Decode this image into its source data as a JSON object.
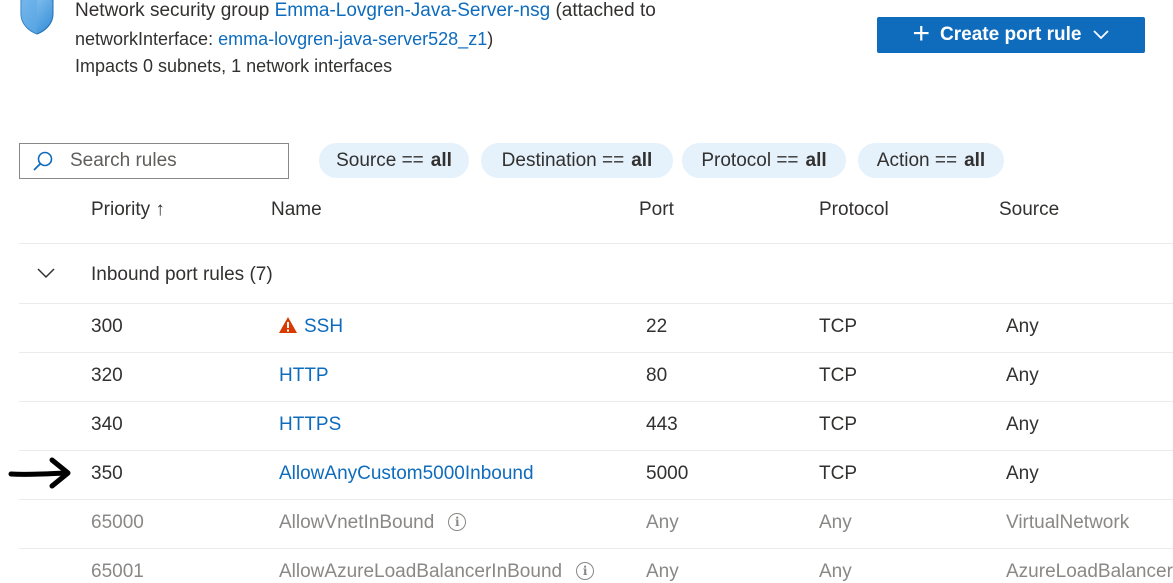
{
  "header": {
    "title_prefix": "Network security group",
    "nsg_name": "Emma-Lovgren-Java-Server-nsg",
    "attached_prefix": "(attached to",
    "interface_label": "networkInterface:",
    "interface_name": "emma-lovgren-java-server528_z1",
    "closing_paren": ")",
    "impacts": "Impacts 0 subnets, 1 network interfaces"
  },
  "toolbar": {
    "create_label": "Create port rule"
  },
  "search": {
    "placeholder": "Search rules",
    "value": ""
  },
  "filters": [
    {
      "label": "Source ==",
      "value": "all"
    },
    {
      "label": "Destination ==",
      "value": "all"
    },
    {
      "label": "Protocol ==",
      "value": "all"
    },
    {
      "label": "Action ==",
      "value": "all"
    }
  ],
  "columns": {
    "priority": "Priority ↑",
    "name": "Name",
    "port": "Port",
    "protocol": "Protocol",
    "source": "Source"
  },
  "group": {
    "label": "Inbound port rules (7)"
  },
  "rules": [
    {
      "priority": "300",
      "name": "SSH",
      "port": "22",
      "protocol": "TCP",
      "source": "Any",
      "warning": true
    },
    {
      "priority": "320",
      "name": "HTTP",
      "port": "80",
      "protocol": "TCP",
      "source": "Any"
    },
    {
      "priority": "340",
      "name": "HTTPS",
      "port": "443",
      "protocol": "TCP",
      "source": "Any"
    },
    {
      "priority": "350",
      "name": "AllowAnyCustom5000Inbound",
      "port": "5000",
      "protocol": "TCP",
      "source": "Any"
    },
    {
      "priority": "65000",
      "name": "AllowVnetInBound",
      "port": "Any",
      "protocol": "Any",
      "source": "VirtualNetwork"
    },
    {
      "priority": "65001",
      "name": "AllowAzureLoadBalancerInBound",
      "port": "Any",
      "protocol": "Any",
      "source": "AzureLoadBalancer"
    }
  ],
  "colors": {
    "accent": "#0f6cbd",
    "pill_bg": "#e5f1fb",
    "warning": "#d83b01",
    "muted_text": "#8a8886"
  }
}
